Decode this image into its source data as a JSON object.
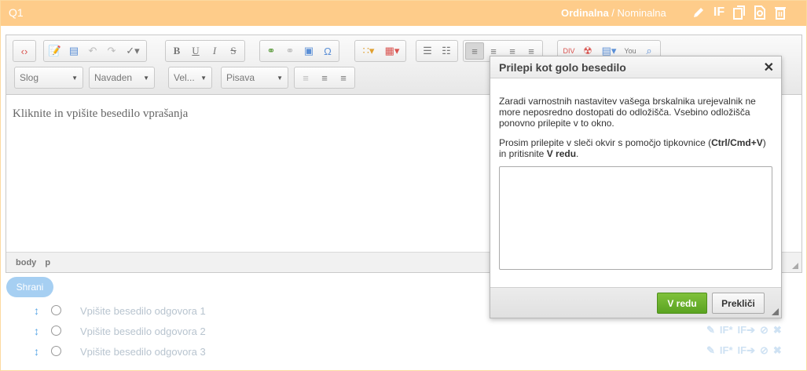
{
  "question": {
    "number": "Q1",
    "type_ordinal": "Ordinalna",
    "type_separator": " / ",
    "type_nominal": "Nominalna",
    "icons": [
      "pencil-icon",
      "if-icon",
      "copy-icon",
      "preview-icon",
      "trash-icon"
    ],
    "if_label": "IF"
  },
  "editor": {
    "combos": {
      "style": "Slog",
      "format": "Navaden",
      "size": "Vel...",
      "font": "Pisava"
    },
    "content_placeholder": "Kliknite in vpišite besedilo vprašanja",
    "status_path": [
      "body",
      "p"
    ]
  },
  "save_label": "Shrani",
  "answers": [
    {
      "text": "Vpišite besedilo odgovora 1"
    },
    {
      "text": "Vpišite besedilo odgovora 2"
    },
    {
      "text": "Vpišite besedilo odgovora 3"
    }
  ],
  "answer_icon_labels": {
    "if": "IF*",
    "if_arrow": "IF➔"
  },
  "dialog": {
    "title": "Prilepi kot golo besedilo",
    "message": "Zaradi varnostnih nastavitev vašega brskalnika urejevalnik ne more neposredno dostopati do odložišča. Vsebino odložišča ponovno prilepite v to okno.",
    "instruction_prefix": "Prosim prilepite v sleči okvir s pomočjo tipkovnice (",
    "instruction_keys": "Ctrl/Cmd+V",
    "instruction_middle": ") in pritisnite ",
    "instruction_ok": "V redu",
    "instruction_suffix": ".",
    "ok_label": "V redu",
    "cancel_label": "Prekliči"
  },
  "colors": {
    "header_bg": "#fecc8a",
    "ok_green": "#6bb22c",
    "save_blue": "#a6cff2"
  }
}
